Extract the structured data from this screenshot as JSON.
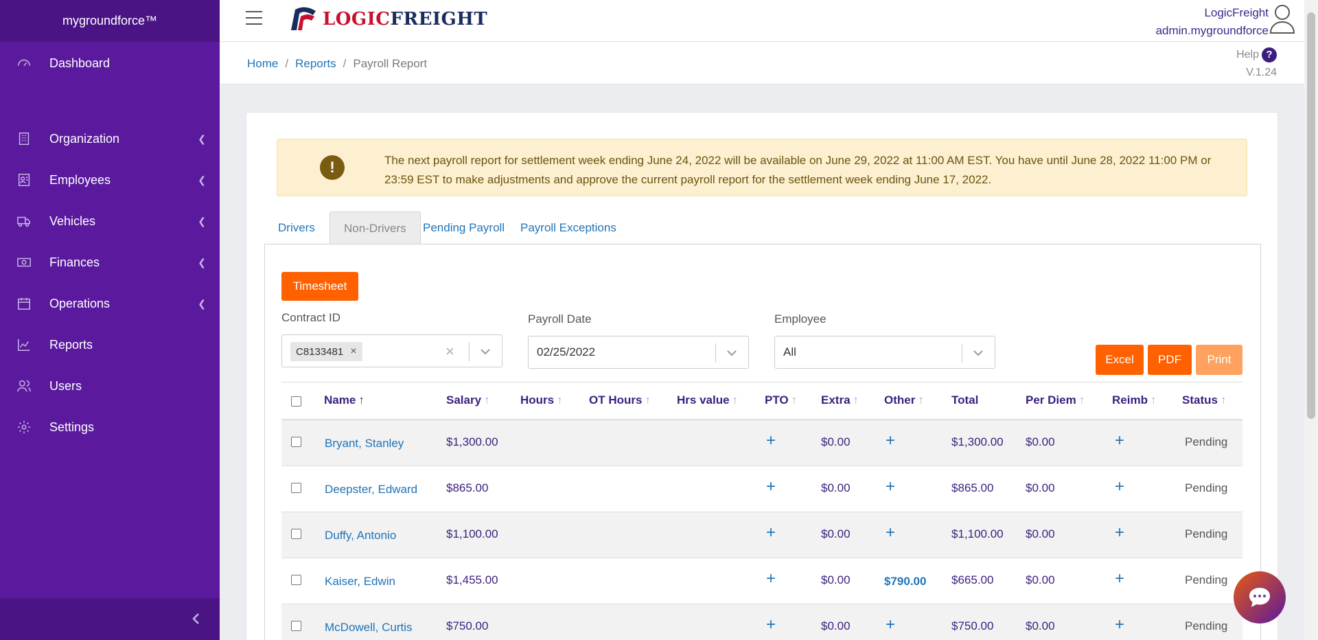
{
  "sidebar": {
    "brand": "mygroundforce™",
    "items": [
      {
        "label": "Dashboard"
      },
      {
        "label": "Organization"
      },
      {
        "label": "Employees"
      },
      {
        "label": "Vehicles"
      },
      {
        "label": "Finances"
      },
      {
        "label": "Operations"
      },
      {
        "label": "Reports"
      },
      {
        "label": "Users"
      },
      {
        "label": "Settings"
      }
    ]
  },
  "header": {
    "logo_part1": "LOGIC",
    "logo_part2": "FREIGHT",
    "company": "LogicFreight",
    "username": "admin.mygroundforce"
  },
  "breadcrumb": {
    "home": "Home",
    "reports": "Reports",
    "current": "Payroll Report",
    "sep": "/"
  },
  "help": {
    "label": "Help",
    "icon": "?",
    "version": "V.1.24"
  },
  "alert": {
    "icon": "!",
    "message": "The next payroll report for settlement week ending June 24, 2022 will be available on June 29, 2022 at 11:00 AM EST. You have until June 28, 2022 11:00 PM or 23:59 EST to make adjustments and approve the current payroll report for the settlement week ending June 17, 2022."
  },
  "tabs": [
    {
      "label": "Drivers"
    },
    {
      "label": "Non-Drivers"
    },
    {
      "label": "Pending Payroll"
    },
    {
      "label": "Payroll Exceptions"
    }
  ],
  "filters": {
    "timesheet_label": "Timesheet",
    "contract_label": "Contract ID",
    "contract_value": "C8133481",
    "payroll_date_label": "Payroll Date",
    "payroll_date_value": "02/25/2022",
    "employee_label": "Employee",
    "employee_value": "All"
  },
  "export": {
    "excel": "Excel",
    "pdf": "PDF",
    "print": "Print"
  },
  "table": {
    "columns": [
      "Name",
      "Salary",
      "Hours",
      "OT Hours",
      "Hrs value",
      "PTO",
      "Extra",
      "Other",
      "Total",
      "Per Diem",
      "Reimb",
      "Status"
    ],
    "sort_icon": "↑",
    "plus_icon": "+",
    "rows": [
      {
        "name": "Bryant, Stanley",
        "salary": "$1,300.00",
        "extra": "$0.00",
        "other": "",
        "total": "$1,300.00",
        "per_diem": "$0.00",
        "status": "Pending"
      },
      {
        "name": "Deepster, Edward",
        "salary": "$865.00",
        "extra": "$0.00",
        "other": "",
        "total": "$865.00",
        "per_diem": "$0.00",
        "status": "Pending"
      },
      {
        "name": "Duffy, Antonio",
        "salary": "$1,100.00",
        "extra": "$0.00",
        "other": "",
        "total": "$1,100.00",
        "per_diem": "$0.00",
        "status": "Pending"
      },
      {
        "name": "Kaiser, Edwin",
        "salary": "$1,455.00",
        "extra": "$0.00",
        "other": "$790.00",
        "total": "$665.00",
        "per_diem": "$0.00",
        "status": "Pending"
      },
      {
        "name": "McDowell, Curtis",
        "salary": "$750.00",
        "extra": "$0.00",
        "other": "",
        "total": "$750.00",
        "per_diem": "$0.00",
        "status": "Pending"
      }
    ]
  }
}
